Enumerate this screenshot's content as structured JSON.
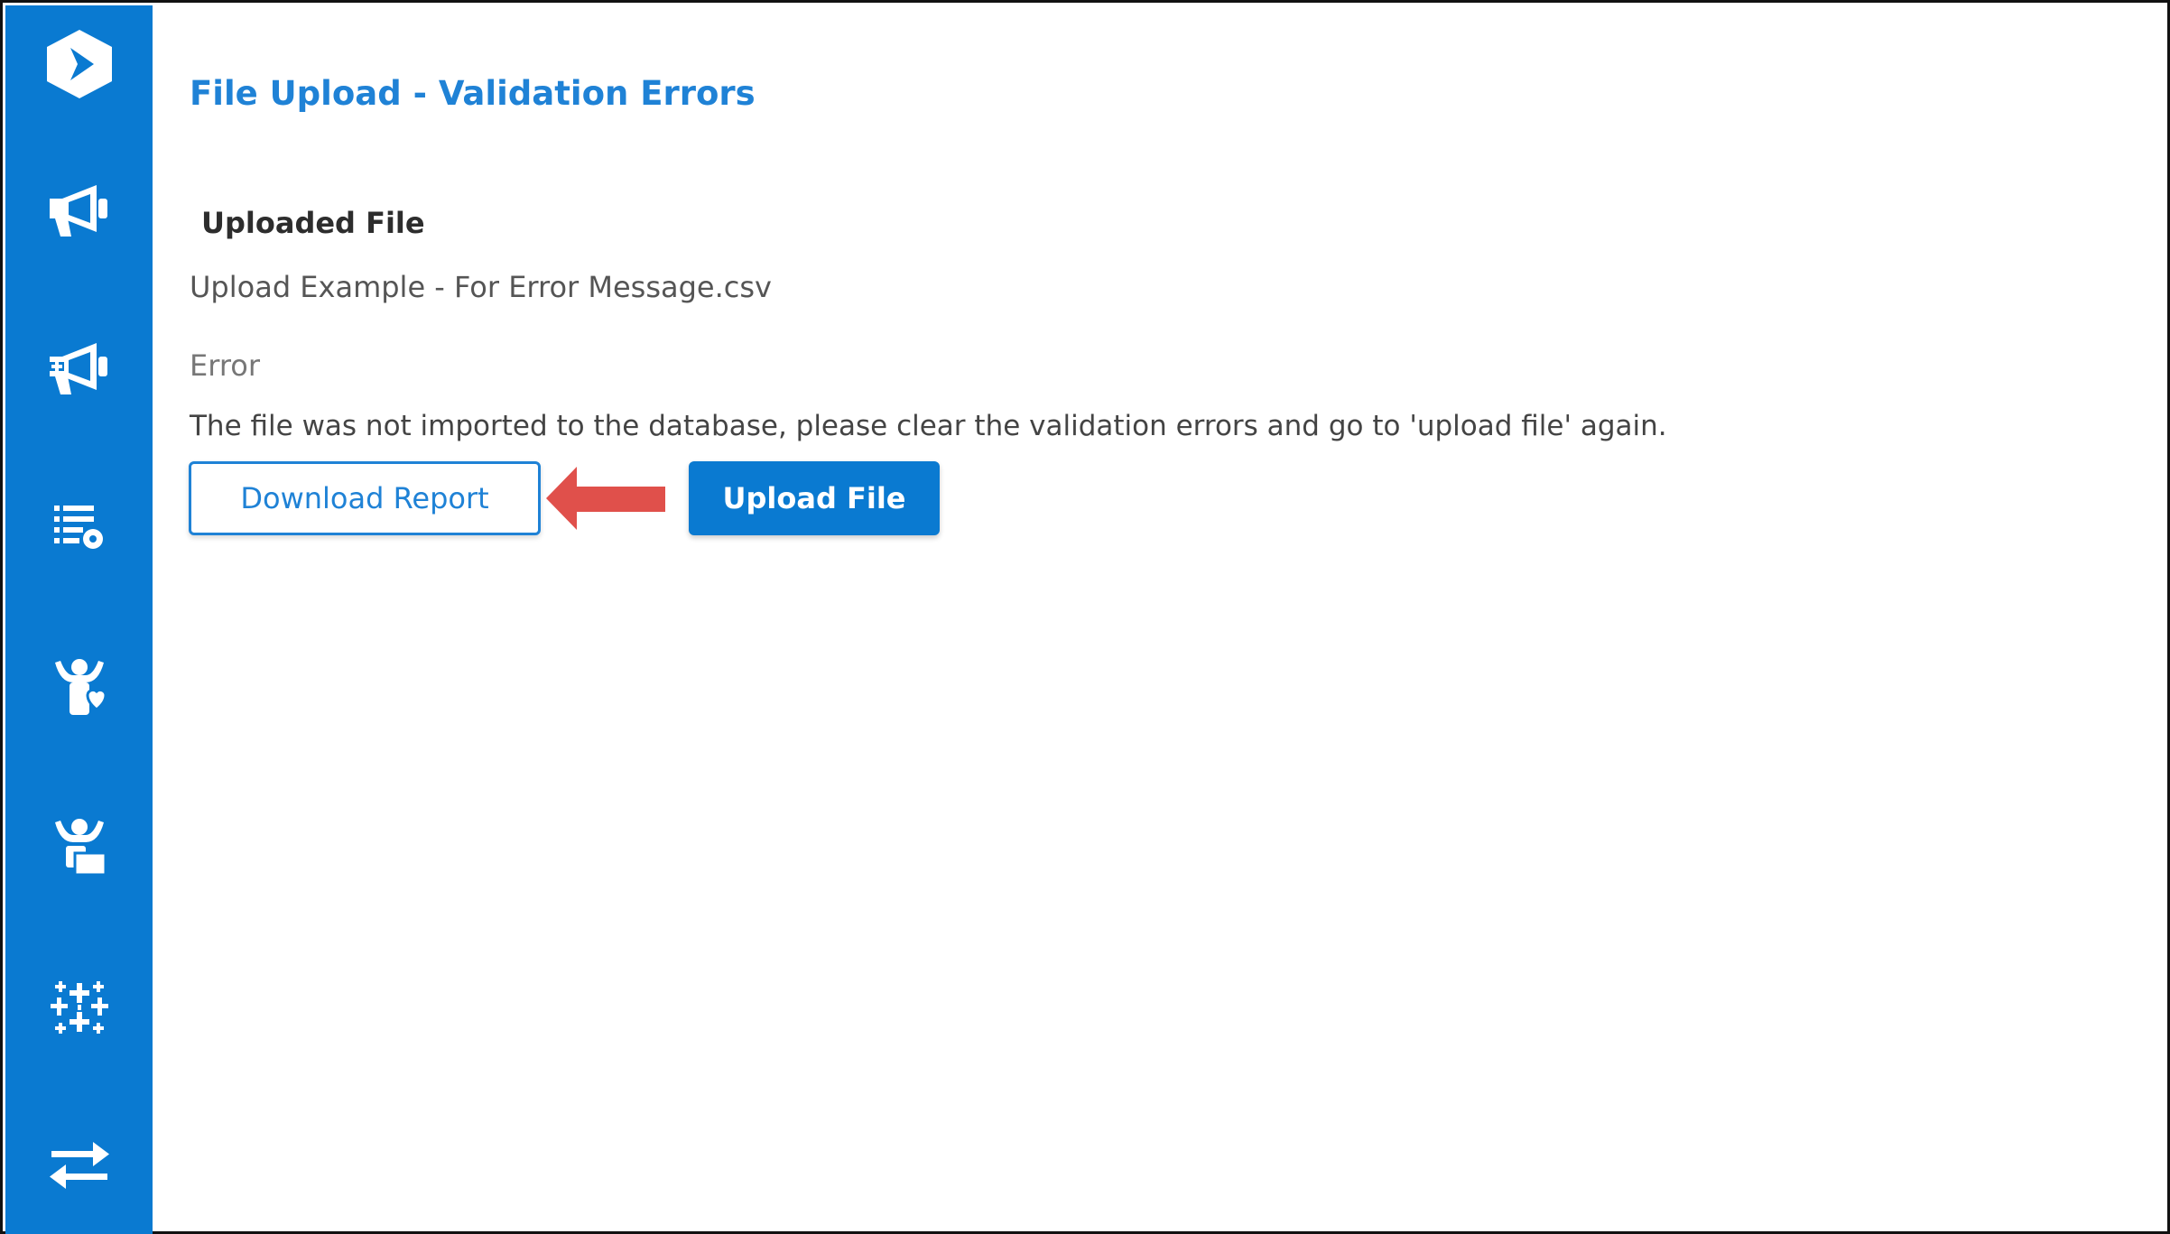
{
  "page": {
    "title": "File Upload - Validation Errors"
  },
  "uploaded_file": {
    "label": "Uploaded File",
    "file_name": "Upload Example - For Error Message.csv"
  },
  "error": {
    "label": "Error",
    "message": "The file was not imported to the database, please clear the validation errors and go to 'upload file' again."
  },
  "actions": {
    "download_report_label": "Download Report",
    "upload_file_label": "Upload File"
  },
  "sidebar": {
    "icons": [
      "app-logo-icon",
      "megaphone-icon",
      "megaphone-add-icon",
      "list-settings-icon",
      "person-heart-icon",
      "person-card-icon",
      "tableau-icon",
      "swap-arrows-icon"
    ]
  },
  "colors": {
    "brand": "#0a7ad1",
    "title": "#1f82d6",
    "annotation_arrow": "#e0504b"
  }
}
